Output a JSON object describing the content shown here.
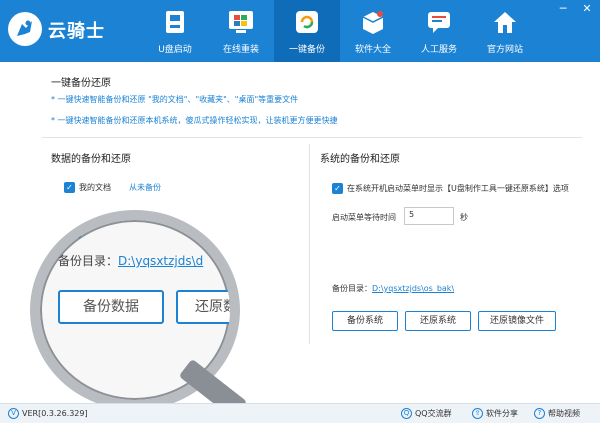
{
  "app": {
    "title": "云骑士"
  },
  "nav": {
    "items": [
      {
        "label": "U盘启动",
        "icon": "usb-icon"
      },
      {
        "label": "在线重装",
        "icon": "windows-icon"
      },
      {
        "label": "一键备份",
        "icon": "backup-icon",
        "active": true
      },
      {
        "label": "软件大全",
        "icon": "software-icon"
      },
      {
        "label": "人工服务",
        "icon": "chat-icon"
      },
      {
        "label": "官方网站",
        "icon": "home-icon"
      }
    ]
  },
  "window_controls": {
    "minimize": "─",
    "close": "✕"
  },
  "backup_restore": {
    "title": "一键备份还原",
    "hint1": "* 一键快速智能备份和还原 \"我的文档\"、\"收藏夹\"、\"桌面\"等重要文件",
    "hint2": "* 一键快速智能备份和还原本机系统，傻瓜式操作轻松实现，让装机更方便更快捷"
  },
  "data_section": {
    "title": "数据的备份和还原",
    "my_docs_label": "我的文档",
    "never_backed_up": "从未备份",
    "backup_dir_label": "备份目录：",
    "backup_dir_path": "D:\\yqsxtzjds\\d",
    "backup_button": "备份数据",
    "restore_button": "还原数"
  },
  "system_section": {
    "title": "系统的备份和还原",
    "boot_menu_option": "在系统开机启动菜单时显示【U盘制作工具一键还原系统】选项",
    "wait_time_label": "启动菜单等待时间",
    "wait_time_value": "5",
    "wait_time_unit": "秒",
    "backup_dir_label": "备份目录：",
    "backup_dir_path": "D:\\yqsxtzjds\\os_bak\\",
    "backup_system_button": "备份系统",
    "restore_system_button": "还原系统",
    "restore_image_button": "还原镜像文件"
  },
  "footer": {
    "version": "VER[0.3.26.329]",
    "qq_group": "QQ交流群",
    "share": "软件分享",
    "help_video": "帮助视频"
  },
  "colors": {
    "primary": "#1b82d4",
    "nav_active": "#0f6cb8"
  }
}
